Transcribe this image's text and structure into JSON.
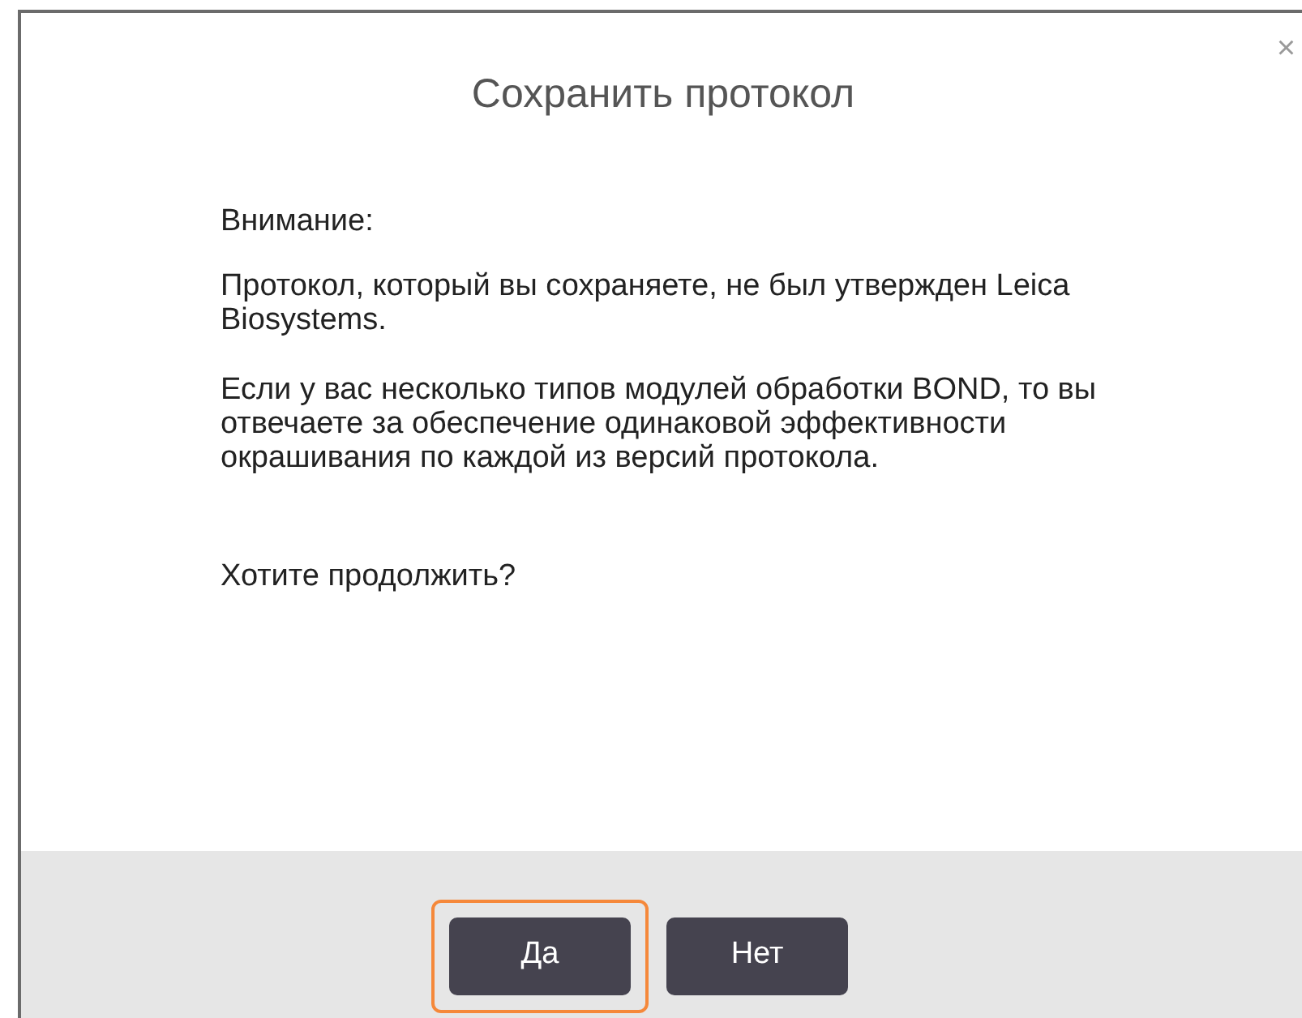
{
  "dialog": {
    "title": "Сохранить протокол",
    "close": "×",
    "paragraphs": [
      "Внимание:",
      "Протокол, который вы сохраняете, не был утвержден Leica Biosystems.",
      "Если у вас несколько типов модулей обработки BOND, то вы отвечаете за обеспечение одинаковой эффективности окрашивания по каждой из версий протокола."
    ],
    "question": "Хотите продолжить?",
    "buttons": [
      {
        "label": "Да",
        "focused": true
      },
      {
        "label": "Нет",
        "focused": false
      }
    ]
  }
}
